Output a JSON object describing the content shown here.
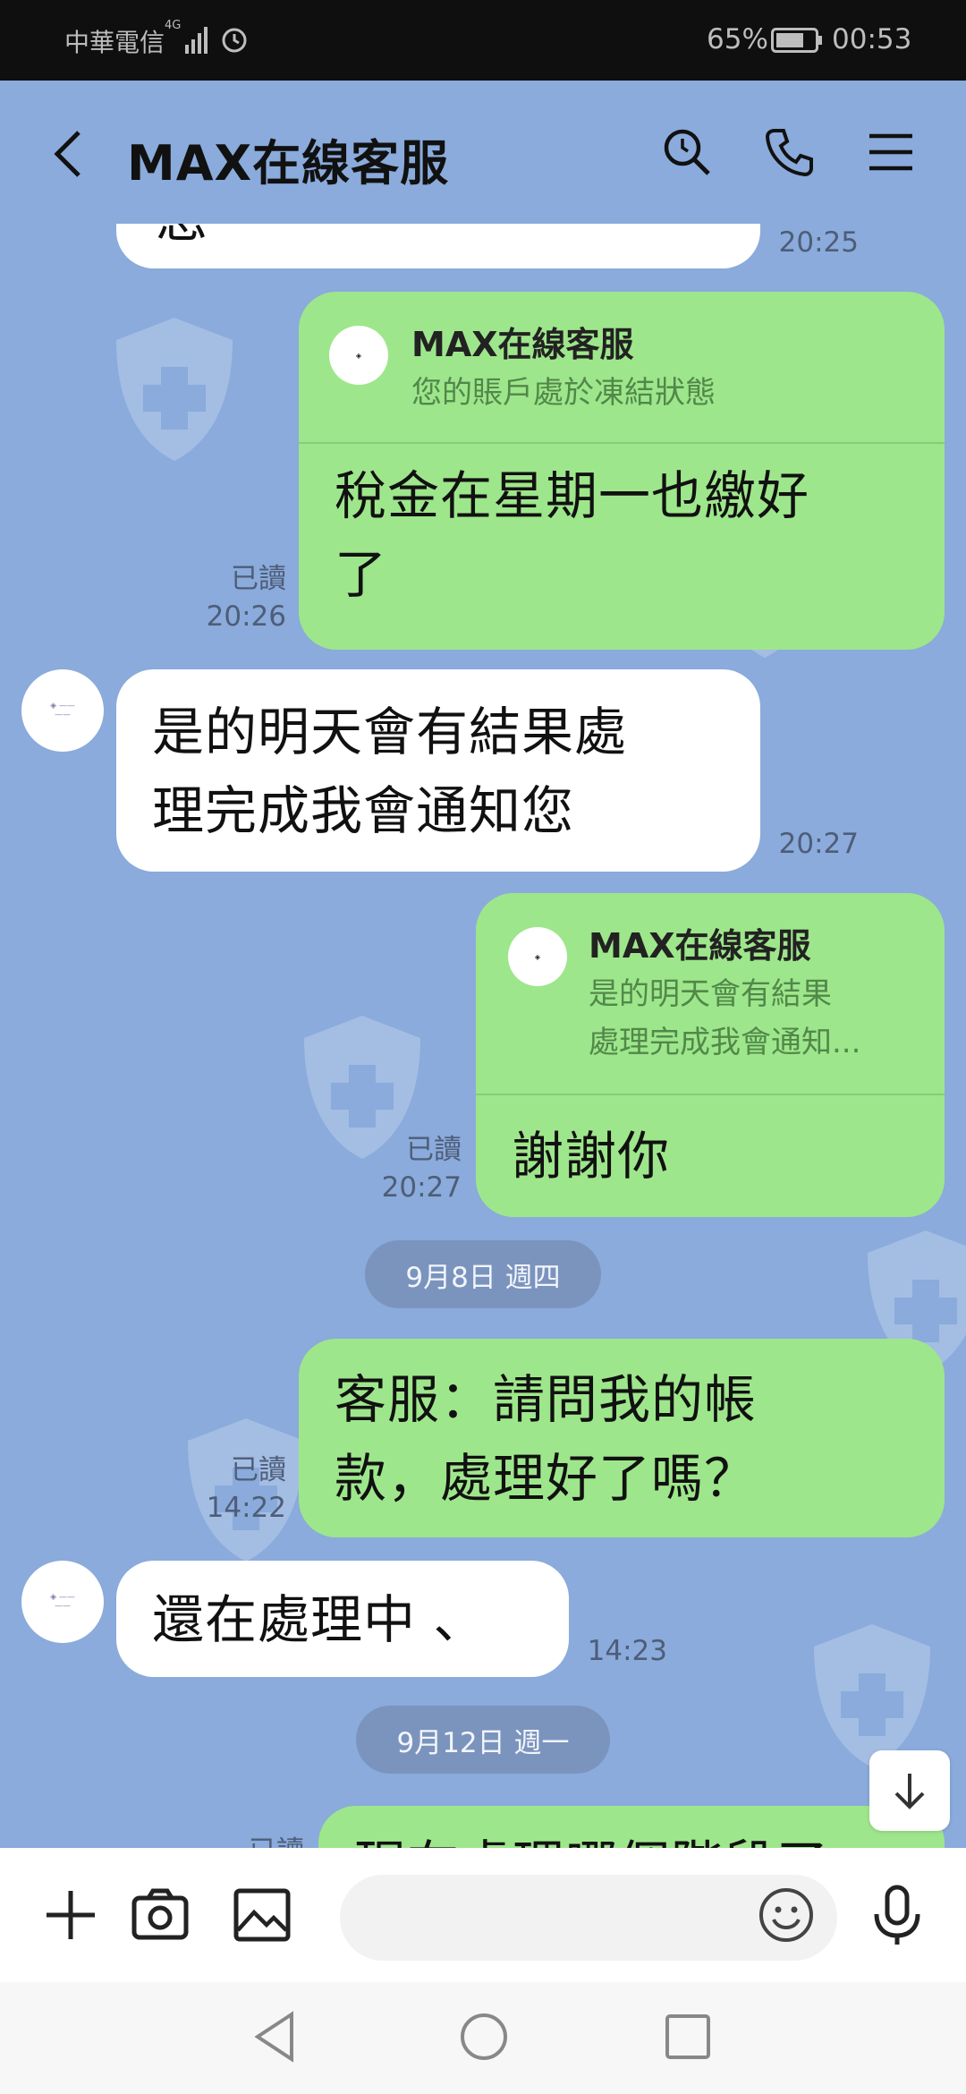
{
  "status_bar": {
    "carrier": "中華電信",
    "network": "4G",
    "battery_percent": "65%",
    "time": "00:53"
  },
  "header": {
    "title": "MAX在線客服",
    "icons": [
      "back-arrow-icon",
      "search-icon",
      "phone-icon",
      "menu-icon"
    ]
  },
  "messages": {
    "m0": {
      "text": "您",
      "time": "20:25"
    },
    "m1": {
      "quote_name": "MAX在線客服",
      "quote_text": "您的賬戶處於凍結狀態",
      "lines": [
        "稅金在星期一也繳好",
        "了"
      ],
      "read": "已讀",
      "time": "20:26"
    },
    "m2": {
      "lines": [
        "是的明天會有結果處",
        "理完成我會通知您"
      ],
      "time": "20:27"
    },
    "m3": {
      "quote_name": "MAX在線客服",
      "quote_lines": [
        "是的明天會有結果",
        "處理完成我會通知..."
      ],
      "text": "謝謝你",
      "read": "已讀",
      "time": "20:27"
    },
    "date1": "9月8日 週四",
    "m4": {
      "lines": [
        "客服：請問我的帳",
        "款，處理好了嗎？"
      ],
      "read": "已讀",
      "time": "14:22"
    },
    "m5": {
      "text": "還在處理中 、",
      "time": "14:23"
    },
    "date2": "9月12日 週一",
    "m6": {
      "text": "現在處理哪個階段了",
      "read": "已讀"
    }
  },
  "input": {
    "placeholder": ""
  },
  "colors": {
    "chat_background": "#8aabdb",
    "outgoing_bubble": "#9ee68b",
    "incoming_bubble": "#ffffff",
    "status_bar": "#0f0f0f"
  }
}
